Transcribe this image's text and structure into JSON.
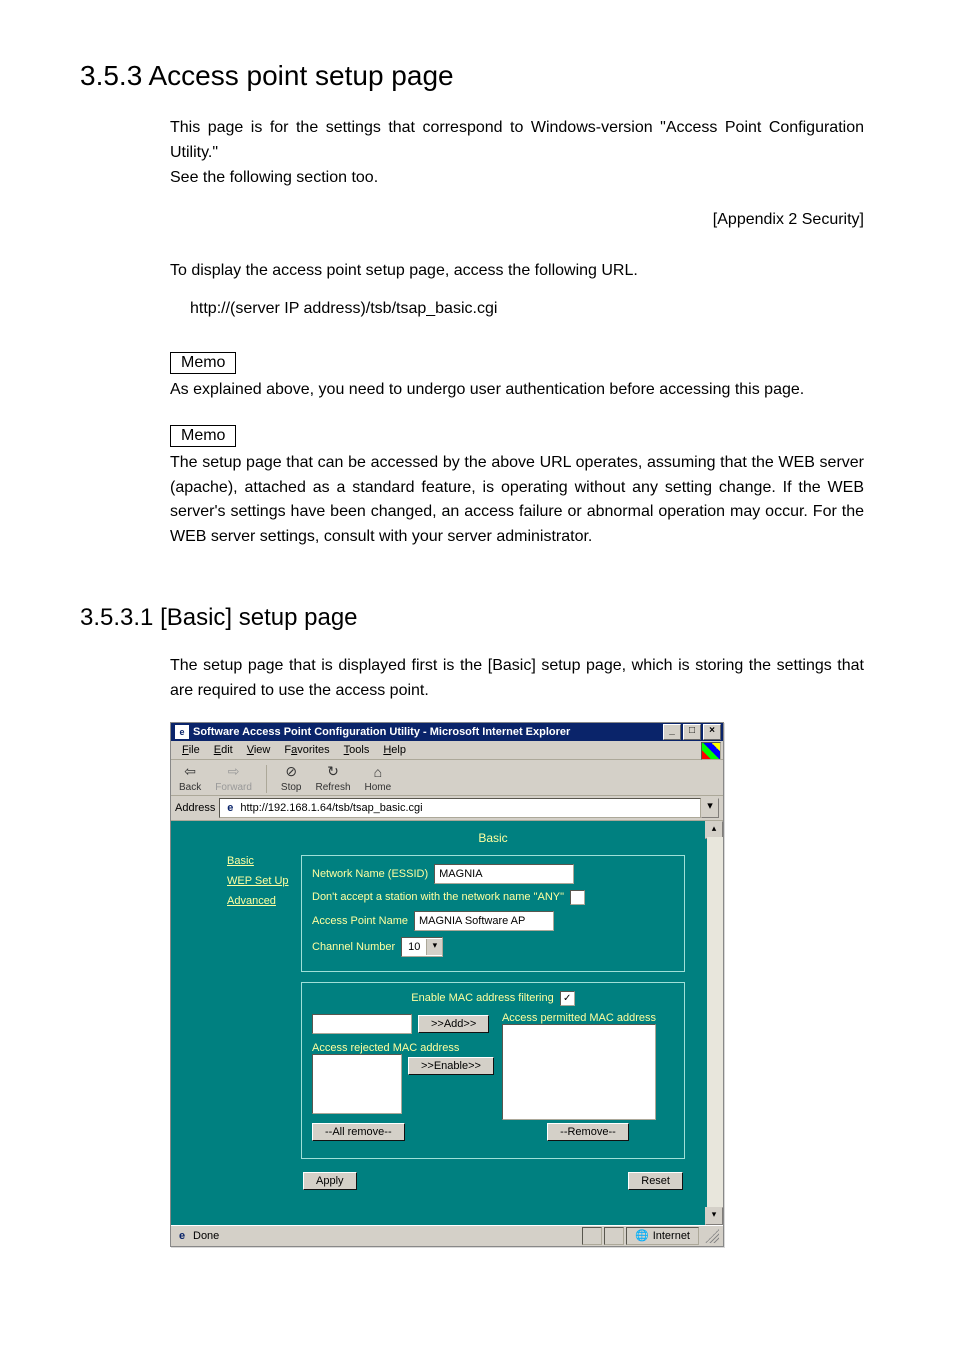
{
  "section353": {
    "heading": "3.5.3  Access point setup page",
    "para1": "This page is for the settings that correspond to Windows-version \"Access Point Configuration Utility.\"",
    "para2": "See the following section too.",
    "appendix": "[Appendix 2   Security]",
    "para3": "To display the access point setup page, access the following URL.",
    "url": "http://(server IP address)/tsb/tsap_basic.cgi",
    "memo1_label": "Memo",
    "memo1_text": "As explained above, you need to undergo user authentication before accessing this page.",
    "memo2_label": "Memo",
    "memo2_text": "The setup page that can be accessed by the above URL operates, assuming that the WEB server (apache), attached as a standard feature, is operating without any setting change.  If the WEB server's settings have been changed, an access failure or abnormal operation may occur.  For the WEB server settings, consult with your server administrator."
  },
  "section3531": {
    "heading": "3.5.3.1  [Basic] setup page",
    "para1": "The setup page that is displayed first is the [Basic] setup page, which is storing the settings that are required to use the access point."
  },
  "ie": {
    "title": "Software Access Point Configuration Utility - Microsoft Internet Explorer",
    "menus": {
      "file": "File",
      "edit": "Edit",
      "view": "View",
      "favorites": "Favorites",
      "tools": "Tools",
      "help": "Help"
    },
    "toolbar": {
      "back": "Back",
      "forward": "Forward",
      "stop": "Stop",
      "refresh": "Refresh",
      "home": "Home"
    },
    "address_label": "Address",
    "address_value": "http://192.168.1.64/tsb/tsap_basic.cgi",
    "nav": {
      "basic": "Basic",
      "wep": "WEP Set Up",
      "advanced": "Advanced"
    },
    "panel": {
      "title": "Basic",
      "essid_label": "Network Name (ESSID)",
      "essid_value": "MAGNIA",
      "any_label": "Don't accept a station with the network name \"ANY\"",
      "any_checked": false,
      "apname_label": "Access Point Name",
      "apname_value": "MAGNIA Software AP",
      "channel_label": "Channel Number",
      "channel_value": "10",
      "macfilter_label": "Enable MAC address filtering",
      "macfilter_checked": true,
      "add_btn": ">>Add>>",
      "permitted_label": "Access permitted MAC address",
      "rejected_label": "Access rejected MAC address",
      "enable_btn": ">>Enable>>",
      "allremove_btn": "--All remove--",
      "remove_btn": "--Remove--",
      "apply_btn": "Apply",
      "reset_btn": "Reset"
    },
    "status_done": "Done",
    "status_zone": "Internet"
  }
}
